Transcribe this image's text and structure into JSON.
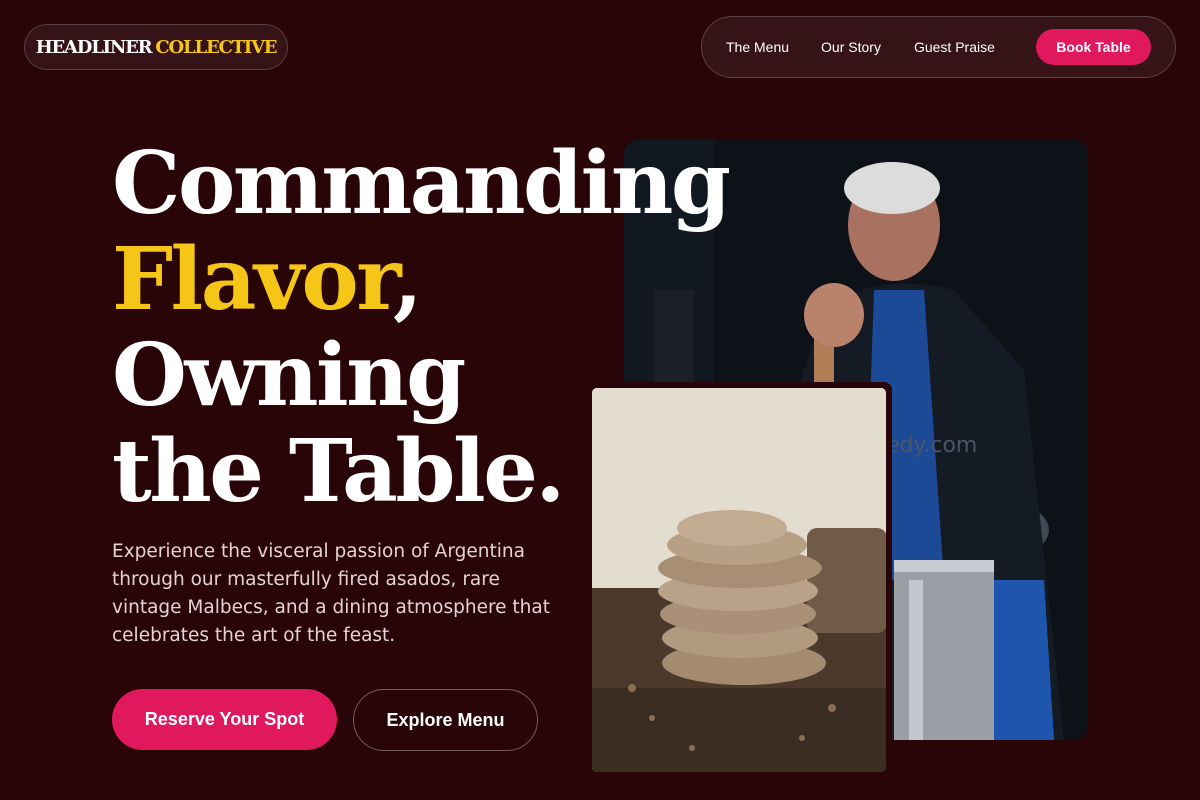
{
  "logo": {
    "part1": "HEADLINER",
    "part2": "COLLECTIVE"
  },
  "nav": {
    "links": [
      "The Menu",
      "Our Story",
      "Guest Praise"
    ],
    "cta": "Book Table"
  },
  "hero": {
    "line1": "Commanding",
    "line2_accent": "Flavor",
    "line2_rest": ",",
    "line3": "Owning",
    "line4": "the Table.",
    "lead": "Experience the visceral passion of Argentina through our masterfully fired asados, rare vintage Malbecs, and a dining atmosphere that celebrates the art of the feast.",
    "primary_button": "Reserve Your Spot",
    "secondary_button": "Explore Menu"
  },
  "watermark": "edy.com",
  "colors": {
    "background": "#2a0508",
    "accent_yellow": "#f5c518",
    "accent_pink": "#e0185e"
  }
}
